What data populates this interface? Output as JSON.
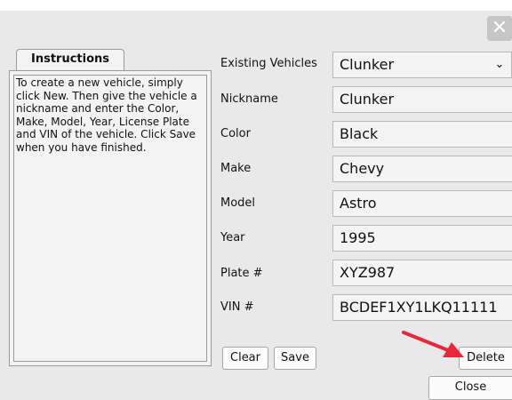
{
  "window": {
    "close_icon": "close-icon"
  },
  "instructions": {
    "tab_label": "Instructions",
    "text": "To create a new vehicle, simply click New. Then give the vehicle a nickname and enter the Color, Make, Model, Year, License Plate and VIN of the vehicle. Click Save when you have finished."
  },
  "form": {
    "existing_vehicles_label": "Existing Vehicles",
    "existing_vehicles_value": "Clunker",
    "nickname_label": "Nickname",
    "nickname_value": "Clunker",
    "color_label": "Color",
    "color_value": "Black",
    "make_label": "Make",
    "make_value": "Chevy",
    "model_label": "Model",
    "model_value": "Astro",
    "year_label": "Year",
    "year_value": "1995",
    "plate_label": "Plate #",
    "plate_value": "XYZ987",
    "vin_label": "VIN #",
    "vin_value": "BCDEF1XY1LKQ11111"
  },
  "buttons": {
    "clear": "Clear",
    "save": "Save",
    "delete": "Delete",
    "close": "Close"
  },
  "annotation": {
    "arrow_color": "#e8273a"
  }
}
